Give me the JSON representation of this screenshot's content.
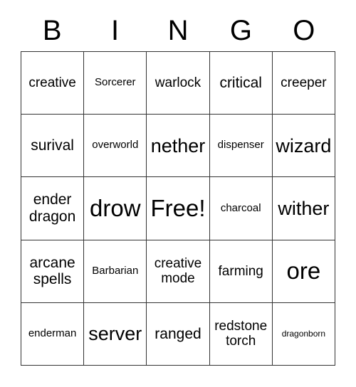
{
  "card": {
    "header_letters": [
      "B",
      "I",
      "N",
      "G",
      "O"
    ],
    "grid": {
      "rows": 5,
      "columns": 5,
      "border_color": "#333333",
      "background_color": "#ffffff",
      "text_color": "#000000"
    },
    "cells": [
      {
        "text": "creative",
        "size": "md"
      },
      {
        "text": "Sorcerer",
        "size": "sm"
      },
      {
        "text": "warlock",
        "size": "md"
      },
      {
        "text": "critical",
        "size": "lg"
      },
      {
        "text": "creeper",
        "size": "md"
      },
      {
        "text": "surival",
        "size": "lg"
      },
      {
        "text": "overworld",
        "size": "sm"
      },
      {
        "text": "nether",
        "size": "xl"
      },
      {
        "text": "dispenser",
        "size": "sm"
      },
      {
        "text": "wizard",
        "size": "xl"
      },
      {
        "text": "ender\ndragon",
        "size": "lg"
      },
      {
        "text": "drow",
        "size": "xxl"
      },
      {
        "text": "Free!",
        "size": "xxl"
      },
      {
        "text": "charcoal",
        "size": "sm"
      },
      {
        "text": "wither",
        "size": "xl"
      },
      {
        "text": "arcane\nspells",
        "size": "lg"
      },
      {
        "text": "Barbarian",
        "size": "sm"
      },
      {
        "text": "creative\nmode",
        "size": "md"
      },
      {
        "text": "farming",
        "size": "md"
      },
      {
        "text": "ore",
        "size": "xxl"
      },
      {
        "text": "enderman",
        "size": "sm"
      },
      {
        "text": "server",
        "size": "xl"
      },
      {
        "text": "ranged",
        "size": "lg"
      },
      {
        "text": "redstone\ntorch",
        "size": "md"
      },
      {
        "text": "dragonborn",
        "size": "xs"
      }
    ]
  }
}
